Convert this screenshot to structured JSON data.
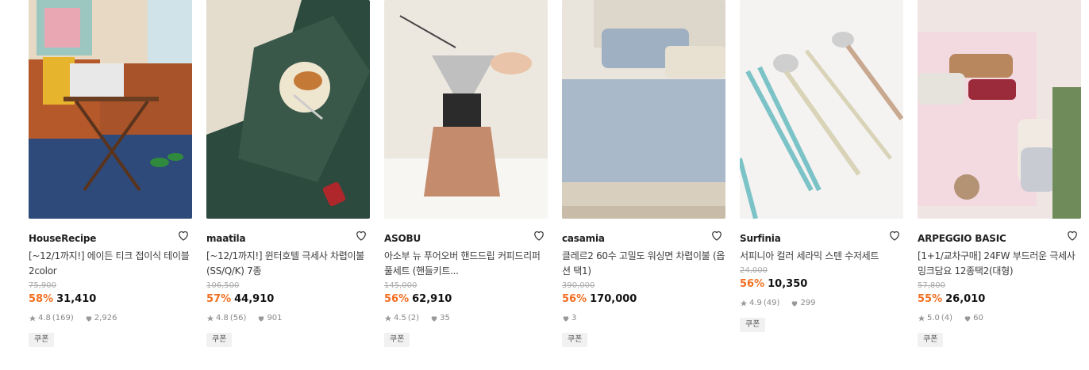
{
  "products": [
    {
      "brand": "HouseRecipe",
      "title": "[~12/1까지!] 에이든 티크 접이식 테이블 2color",
      "original_price": "75,900",
      "discount": "58%",
      "price": "31,410",
      "rating": "4.8",
      "reviews": "(169)",
      "likes": "2,926",
      "badge": "쿠폰",
      "image": "living-room-table"
    },
    {
      "brand": "maatila",
      "title": "[~12/1까지!] 윈터호텔 극세사 차렵이불 (SS/Q/K) 7종",
      "original_price": "106,500",
      "discount": "57%",
      "price": "44,910",
      "rating": "4.8",
      "reviews": "(56)",
      "likes": "901",
      "badge": "쿠폰",
      "image": "green-bedding"
    },
    {
      "brand": "ASOBU",
      "title": "아소부 뉴 푸어오버 핸드드립 커피드리퍼 풀세트 (핸들키트...",
      "original_price": "145,000",
      "discount": "56%",
      "price": "62,910",
      "rating": "4.5",
      "reviews": "(2)",
      "likes": "35",
      "badge": "쿠폰",
      "image": "coffee-dripper"
    },
    {
      "brand": "casamia",
      "title": "클레르2 60수 고밀도 워싱면 차렵이불 (옵션 택1)",
      "original_price": "390,000",
      "discount": "56%",
      "price": "170,000",
      "rating": "",
      "reviews": "",
      "likes": "3",
      "badge": "쿠폰",
      "image": "grey-bedding"
    },
    {
      "brand": "Surfinia",
      "title": "서피니아 컬러 세라믹 스텐 수저세트",
      "original_price": "24,000",
      "discount": "56%",
      "price": "10,350",
      "rating": "4.9",
      "reviews": "(49)",
      "likes": "299",
      "badge": "쿠폰",
      "image": "cutlery-set"
    },
    {
      "brand": "ARPEGGIO BASIC",
      "title": "[1+1/교차구매] 24FW 부드러운 극세사 밍크담요 12종택2(대형)",
      "original_price": "57,800",
      "discount": "55%",
      "price": "26,010",
      "rating": "5.0",
      "reviews": "(4)",
      "likes": "60",
      "badge": "쿠폰",
      "image": "mink-blanket"
    }
  ],
  "colors": {
    "discount": "#f36f21",
    "meta": "#888888",
    "strike": "#aaaaaa"
  }
}
